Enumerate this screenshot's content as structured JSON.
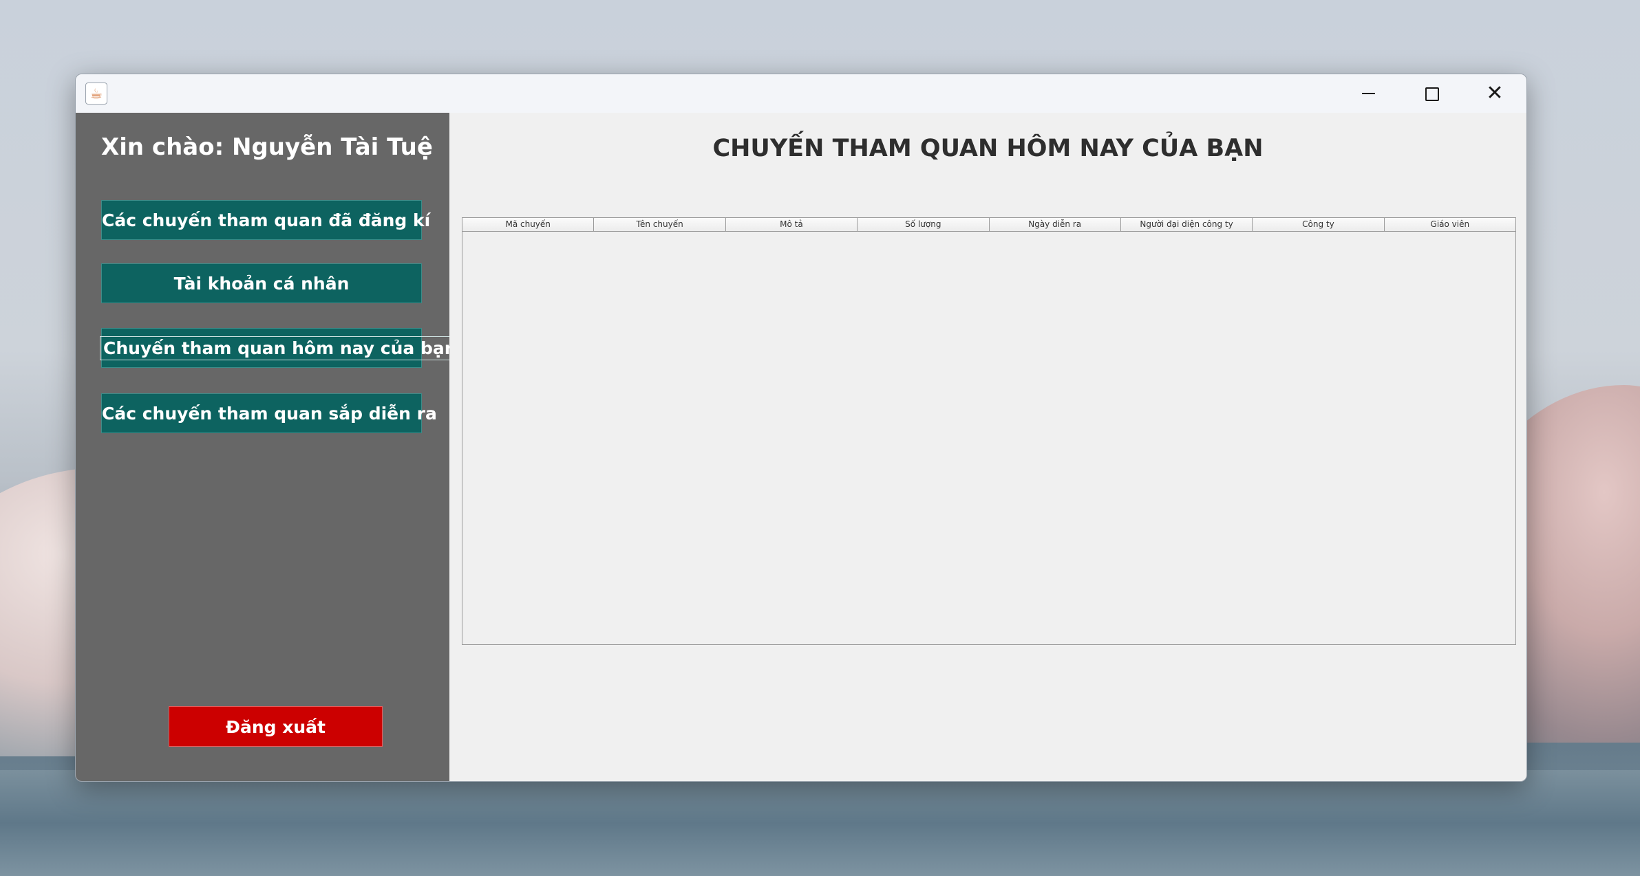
{
  "window": {
    "controls": {
      "minimize_icon": "minimize-icon",
      "maximize_icon": "maximize-icon",
      "close_icon": "close-icon",
      "close_glyph": "✕"
    },
    "app_icon_glyph": "☕"
  },
  "sidebar": {
    "greeting": "Xin chào: Nguyễn Tài Tuệ",
    "items": [
      {
        "label": "Các chuyến tham quan đã đăng kí"
      },
      {
        "label": "Tài khoản cá nhân"
      },
      {
        "label": "Chuyến tham quan hôm nay của bạn",
        "focused": true
      },
      {
        "label": "Các chuyến tham quan sắp diễn ra"
      }
    ],
    "logout_label": "Đăng xuất"
  },
  "main": {
    "title": "CHUYẾN THAM QUAN HÔM NAY CỦA BẠN",
    "table": {
      "columns": [
        "Mã chuyến",
        "Tên chuyến",
        "Mô tả",
        "Số lượng",
        "Ngày diễn ra",
        "Người đại diện công ty",
        "Công ty",
        "Giáo viên"
      ],
      "rows": []
    }
  },
  "colors": {
    "sidebar_bg": "#676767",
    "nav_button_bg": "#0d6360",
    "logout_bg": "#cc0000",
    "content_bg": "#f0f0f0"
  }
}
